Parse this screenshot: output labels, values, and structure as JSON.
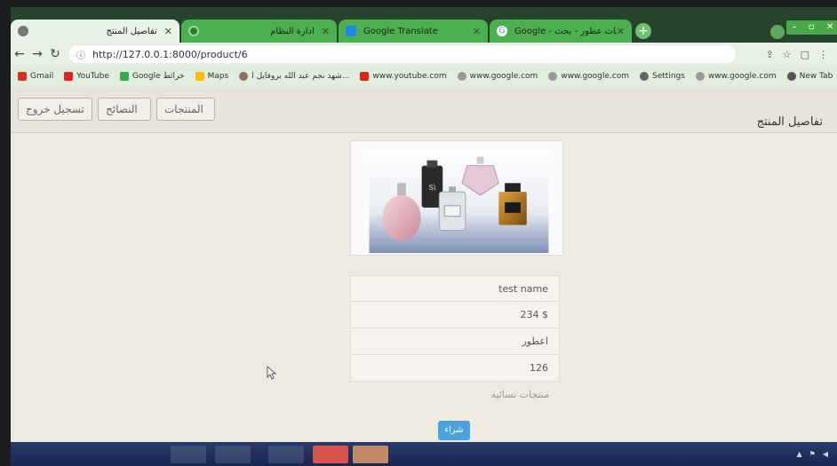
{
  "browser": {
    "tabs": [
      {
        "title": "تفاصيل المنتج",
        "active": true
      },
      {
        "title": "ادارة النظام",
        "active": false
      },
      {
        "title": "Google Translate",
        "active": false
      },
      {
        "title": "Google - صور اعلانات عطور - بحث",
        "active": false
      }
    ],
    "address": "http://127.0.0.1:8000/product/6",
    "bookmarks": [
      "Gmail",
      "YouTube",
      "Google خرائط",
      "Maps",
      "شهد نجم عبد الله بروفايل ا...",
      "www.youtube.com",
      "www.google.com",
      "www.google.com",
      "Settings",
      "www.google.com",
      "New Tab"
    ]
  },
  "navbar": {
    "logout": "تسجيل خروج",
    "tips": "النصائح",
    "products": "المنتجات"
  },
  "page": {
    "title": "تفاصيل المنتج"
  },
  "product": {
    "name": "test name",
    "price": "234 $",
    "category": "اعطور",
    "quantity": "126",
    "type": "منتجات نسائيه",
    "buy_label": "شراء"
  },
  "colors": {
    "accent": "#4aa3df",
    "chrome_green": "#4caf50"
  },
  "icons": [
    "back-arrow-icon",
    "forward-arrow-icon",
    "reload-icon",
    "info-icon",
    "share-icon",
    "star-icon",
    "extension-icon",
    "close-icon"
  ]
}
